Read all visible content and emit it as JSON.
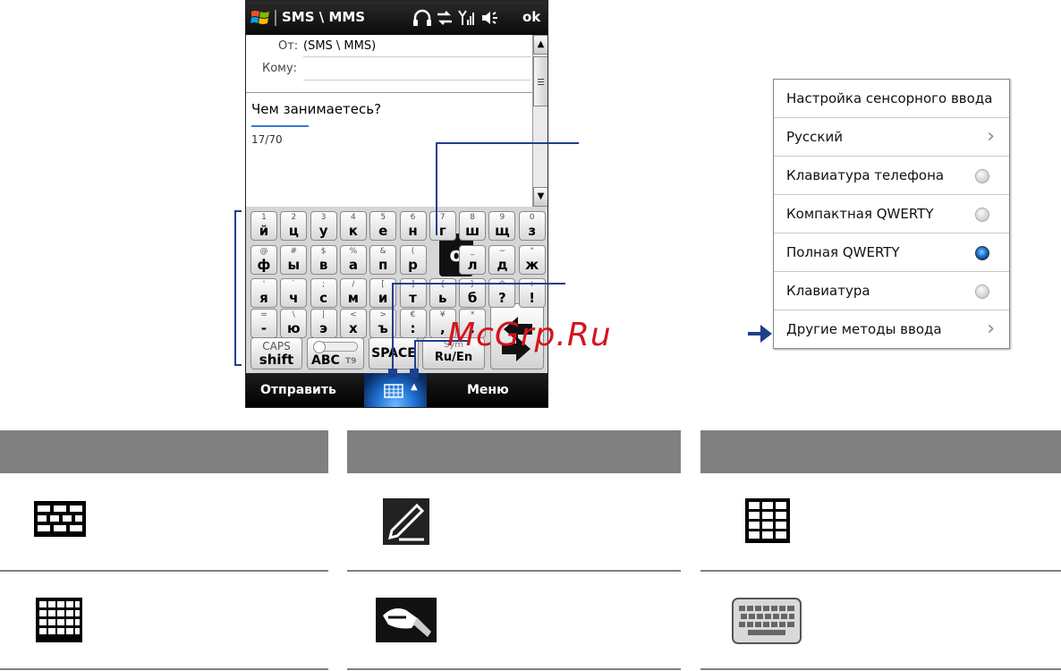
{
  "titlebar": {
    "title": "SMS \\ MMS",
    "ok": "ok"
  },
  "message": {
    "from_label": "От:",
    "from_value": "(SMS \\ MMS)",
    "to_label": "Кому:",
    "body": "Чем занимаетесь?",
    "counter": "17/70"
  },
  "keyboard": {
    "rows": [
      [
        [
          "1",
          "й"
        ],
        [
          "2",
          "ц"
        ],
        [
          "3",
          "у"
        ],
        [
          "4",
          "к"
        ],
        [
          "5",
          "е"
        ],
        [
          "6",
          "н"
        ],
        [
          "7",
          "г"
        ],
        [
          "8",
          "ш"
        ],
        [
          "9",
          "щ"
        ],
        [
          "0",
          "з"
        ]
      ],
      [
        [
          "@",
          "ф"
        ],
        [
          "#",
          "ы"
        ],
        [
          "$",
          "в"
        ],
        [
          "%",
          "а"
        ],
        [
          "&",
          "п"
        ],
        [
          "(",
          "р"
        ],
        [
          "",
          "о"
        ],
        [
          "_",
          "л"
        ],
        [
          "~",
          "д"
        ],
        [
          "\"",
          "ж"
        ]
      ],
      [
        [
          "'",
          "я"
        ],
        [
          "`",
          "ч"
        ],
        [
          ";",
          "с"
        ],
        [
          "/",
          "м"
        ],
        [
          "[",
          "и"
        ],
        [
          "]",
          "т"
        ],
        [
          "{",
          "ь"
        ],
        [
          "}",
          "б"
        ],
        [
          "^",
          "?"
        ],
        [
          "+",
          "!"
        ]
      ],
      [
        [
          "=",
          "-"
        ],
        [
          "\\",
          "ю"
        ],
        [
          "|",
          "э"
        ],
        [
          "<",
          "х"
        ],
        [
          ">",
          "ъ"
        ],
        [
          "€",
          ":"
        ],
        [
          "¥",
          ","
        ],
        [
          "*",
          "."
        ]
      ]
    ],
    "popup_letter": "о",
    "caps_top": "CAPS",
    "caps_bottom": "shift",
    "abc": "ABC",
    "t9": "T9",
    "space": "SPACE",
    "lang": "Ru/En",
    "lang_top": "Sym"
  },
  "softkeys": {
    "left": "Отправить",
    "right": "Меню"
  },
  "menu": {
    "items": [
      {
        "label": "Настройка сенсорного ввода",
        "kind": "plain"
      },
      {
        "label": "Русский",
        "kind": "submenu"
      },
      {
        "label": "Клавиатура телефона",
        "kind": "radio",
        "selected": false
      },
      {
        "label": "Компактная QWERTY",
        "kind": "radio",
        "selected": false
      },
      {
        "label": "Полная QWERTY",
        "kind": "radio",
        "selected": true
      },
      {
        "label": "Клавиатура",
        "kind": "radio",
        "selected": false
      },
      {
        "label": "Другие методы ввода",
        "kind": "submenu"
      }
    ]
  },
  "watermark": "McGrp.Ru",
  "colors": {
    "callout": "#1f3f8f",
    "header_gray": "#808080",
    "ime_blue": "#1e6fd0"
  },
  "icons": {
    "table_row1": [
      "full-qwerty-keyboard-icon",
      "pen-handwriting-icon",
      "phone-keypad-icon"
    ],
    "table_row2": [
      "compact-qwerty-keyboard-icon",
      "transcriber-icon",
      "keyboard-icon"
    ]
  }
}
